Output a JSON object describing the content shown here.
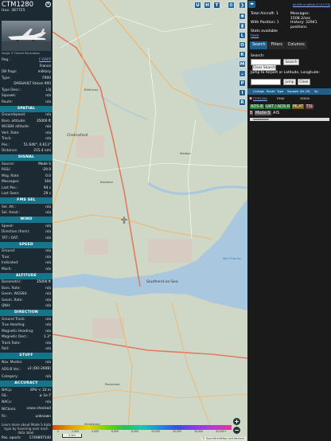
{
  "sidebar": {
    "callsign": "CTM1280",
    "hex_label": "Hex:",
    "hex_value": "3B77E5",
    "close_glyph": "×",
    "photo_credit": "Image © Florent Renaudeau",
    "info_rows": [
      {
        "label": "Reg.:",
        "value": "F-RAFP",
        "link": true
      },
      {
        "label": "",
        "value": "France"
      },
      {
        "label": "DB flags:",
        "value": "military"
      },
      {
        "label": "Type:",
        "value": "F900"
      },
      {
        "label": "",
        "value": "DASSAULT Falcon 900"
      },
      {
        "label": "Type Desc.:",
        "value": "L3J"
      },
      {
        "label": "Squawk:",
        "value": "n/a"
      },
      {
        "label": "Route:",
        "value": "n/a"
      }
    ],
    "sections": {
      "spatial": "SPATIAL",
      "signal": "SIGNAL",
      "fms_sel": "FMS SEL",
      "wind": "WIND",
      "speed": "SPEED",
      "altitude": "ALTITUDE",
      "direction": "DIRECTION",
      "stuff": "STUFF",
      "accuracy": "ACCURACY"
    },
    "spatial_rows": [
      {
        "label": "Groundspeed:",
        "value": "n/a"
      },
      {
        "label": "Baro. altitude:",
        "value": "35000 ft"
      },
      {
        "label": "WGS84 altitude:",
        "value": "n/a"
      },
      {
        "label": "Vert. Rate:",
        "value": "n/a"
      },
      {
        "label": "Track:",
        "value": "n/a"
      },
      {
        "label": "Pos.:",
        "value": "51.640°, 0.613°"
      },
      {
        "label": "Distance:",
        "value": "215.4 nmi"
      }
    ],
    "signal_rows": [
      {
        "label": "Source:",
        "value": "Mode S"
      },
      {
        "label": "RSSI:",
        "value": "-29.9"
      },
      {
        "label": "Msg. Rate:",
        "value": "0.0"
      },
      {
        "label": "Messages:",
        "value": "104"
      },
      {
        "label": "Last Pos.:",
        "value": "94 s"
      },
      {
        "label": "Last Seen:",
        "value": "29 s"
      }
    ],
    "fms_rows": [
      {
        "label": "Sel. Alt.:",
        "value": "n/a"
      },
      {
        "label": "Sel. Head.:",
        "value": "n/a"
      }
    ],
    "wind_rows": [
      {
        "label": "Speed:",
        "value": "n/a"
      },
      {
        "label": "Direction (from):",
        "value": "n/a"
      },
      {
        "label": "TAT / OAT:",
        "value": "n/a"
      }
    ],
    "speed_rows": [
      {
        "label": "Ground:",
        "value": "n/a"
      },
      {
        "label": "True:",
        "value": "n/a"
      },
      {
        "label": "Indicated:",
        "value": "n/a"
      },
      {
        "label": "Mach:",
        "value": "n/a"
      }
    ],
    "altitude_rows": [
      {
        "label": "Barometric:",
        "value": "35000 ft"
      },
      {
        "label": "Baro. Rate:",
        "value": "n/a"
      },
      {
        "label": "Geom. WGS84:",
        "value": "n/a"
      },
      {
        "label": "Geom. Rate:",
        "value": "n/a"
      },
      {
        "label": "QNH:",
        "value": "n/a"
      }
    ],
    "direction_rows": [
      {
        "label": "Ground Track:",
        "value": "n/a"
      },
      {
        "label": "True Heading:",
        "value": "n/a"
      },
      {
        "label": "Magnetic Heading:",
        "value": "n/a"
      },
      {
        "label": "Magnetic Decl.:",
        "value": "1.3°"
      },
      {
        "label": "Track Rate:",
        "value": "n/a"
      },
      {
        "label": "Roll:",
        "value": "n/a"
      }
    ],
    "stuff_rows": [
      {
        "label": "Nav. Modes:",
        "value": "n/a"
      },
      {
        "label": "ADS-B Ver.:",
        "value": "v2 (DO-260B)"
      },
      {
        "label": "Category:",
        "value": "n/a"
      }
    ],
    "accuracy_rows": [
      {
        "label": "NACp:",
        "value": "EPU < 10 m"
      },
      {
        "label": "SIL:",
        "value": "≤ 1e-7"
      },
      {
        "label": "NACv:",
        "value": "n/a"
      },
      {
        "label": "NICbaro:",
        "value": "cross-checked"
      },
      {
        "label": "Rc:",
        "value": "unknown"
      }
    ],
    "note": "Learn more about Mode S data type by hovering over each data label.",
    "pos_epoch_label": "Pos. epoch:",
    "pos_epoch_value": "1749897540"
  },
  "map": {
    "top_buttons": [
      "U",
      "H",
      "T"
    ],
    "side_buttons": [
      "L",
      "O",
      "K",
      "M",
      "P",
      "I",
      "R"
    ],
    "zoom_in": "+",
    "zoom_out": "−",
    "scale_text": "2 km",
    "altitude_ticks": [
      "0",
      "2,000",
      "4,000",
      "6,000",
      "8,000",
      "10,000",
      "20,000",
      "30,000",
      "40,000+"
    ],
    "attribution": "© OpenStreetMap contributors.",
    "places": [
      {
        "name": "Chelmsford",
        "cls": "big"
      },
      {
        "name": "Southend-on-Sea",
        "cls": "big"
      },
      {
        "name": "Mid Thames",
        "cls": "water"
      },
      {
        "name": "Rochester",
        "cls": ""
      },
      {
        "name": "Maidstone",
        "cls": ""
      },
      {
        "name": "Basildon",
        "cls": ""
      },
      {
        "name": "Billericay",
        "cls": ""
      },
      {
        "name": "Maldon",
        "cls": ""
      }
    ]
  },
  "right_panel": {
    "collapse_glyph": "◂▸",
    "version_link": "tar1090 on github (3.14.1716)",
    "stats": {
      "total_label": "Total Aircraft:",
      "total_value": "1",
      "messages_label": "Messages:",
      "messages_value": "1508.2/sec",
      "with_pos_label": "With Position:",
      "with_pos_value": "1",
      "history_label": "History:",
      "history_value": "32941 positions",
      "stats_avail": "Stats available",
      "here": "here"
    },
    "tabs": [
      "Search",
      "Filters",
      "Columns"
    ],
    "search_label": "Search:",
    "search_button": "Search",
    "clear_search_button": "Clear Search",
    "jump_label": "Jump to Airport or Latitude, Longitude:",
    "jump_button": "Jump",
    "clear_button": "Clear",
    "columns": [
      "",
      "Callsign",
      "Route",
      "Type",
      "Squawk",
      "Alt. (ft)",
      "Sp"
    ],
    "row": {
      "flag": "",
      "callsign": "CTM1280",
      "route": "",
      "type": "F900",
      "squawk": "",
      "alt": "35000"
    },
    "legend": [
      {
        "label": "ADS-B",
        "bg": "#2c7a3b"
      },
      {
        "label": "UAT / ADS-R",
        "bg": "#2c7a3b"
      },
      {
        "label": "MLAT",
        "bg": "#7a5a10"
      },
      {
        "label": "TIS-B",
        "bg": "#6a3a3a"
      },
      {
        "label": "Mode-S",
        "bg": "#5a5a5a"
      },
      {
        "label": "AIS",
        "bg": "#1a1a1a"
      }
    ]
  }
}
